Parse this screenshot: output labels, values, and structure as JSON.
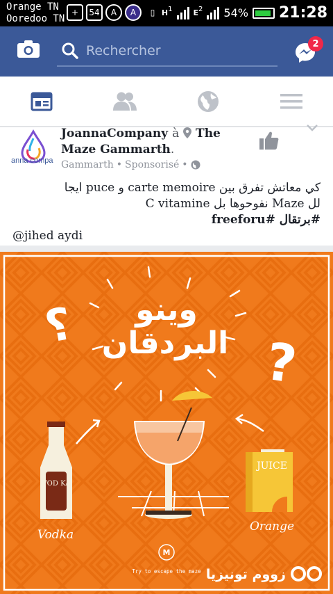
{
  "status": {
    "carrier_1": "Orange TN",
    "carrier_2": "Ooredoo TN",
    "notif_count": "54",
    "sim1": "1",
    "sim2": "2",
    "net1": "H",
    "net2": "E",
    "battery": "54%",
    "time": "21:28"
  },
  "topbar": {
    "search_placeholder": "Rechercher",
    "messages_badge": "2",
    "accent": "#3b5998"
  },
  "tabs": [
    {
      "name": "news-feed",
      "active": true
    },
    {
      "name": "friends",
      "active": false
    },
    {
      "name": "notifications",
      "active": false
    },
    {
      "name": "menu",
      "active": false
    }
  ],
  "post": {
    "page_name": "JoannaCompany",
    "at_word": "à",
    "location": "The Maze Gammarth",
    "location_suffix": ".",
    "city": "Gammarth",
    "sponsored": "Sponsorisé",
    "avatar_text": "anna compa",
    "line1": "كي معاتش تفرق بين carte memoire و puce ايجا",
    "line2": "لل Maze نفوحوها بل C vitamine",
    "line3": "#برتقال #freeforu",
    "mention": "@jihed aydi"
  },
  "ad_image": {
    "headline_1": "وينو",
    "headline_2": "البردقان",
    "label_vodka_bottle": "VOD KA",
    "label_juice": "JUICE",
    "caption_vodka": "Vodka",
    "caption_orange": "Orange",
    "brand": "M",
    "tagline": "Try to escape the maze",
    "watermark": "زووم تونيزيا",
    "bg_color": "#f07a1c"
  }
}
